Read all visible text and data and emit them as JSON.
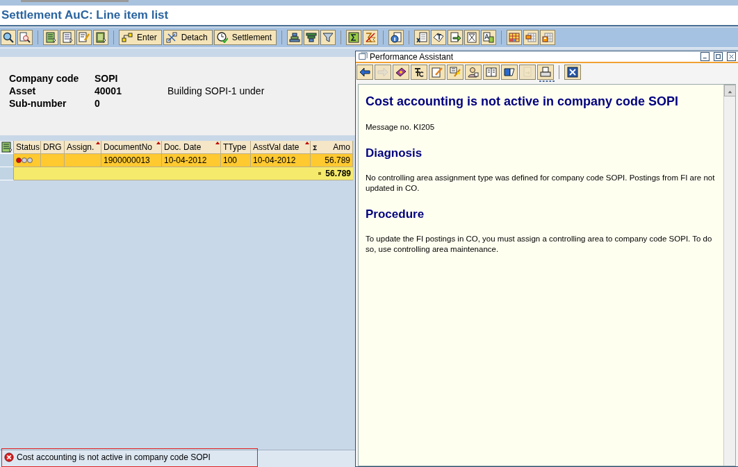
{
  "window": {
    "title": "Settlement AuC: Line item list"
  },
  "toolbar": [
    {
      "kind": "icon"
    },
    {
      "kind": "icon"
    },
    {
      "kind": "separator"
    },
    {
      "kind": "icon"
    },
    {
      "kind": "icon"
    },
    {
      "kind": "icon"
    },
    {
      "kind": "icon"
    },
    {
      "kind": "separator"
    },
    {
      "kind": "text",
      "label": "Enter"
    },
    {
      "kind": "text",
      "label": "Detach"
    },
    {
      "kind": "text",
      "label": "Settlement"
    },
    {
      "kind": "separator"
    },
    {
      "kind": "icon"
    },
    {
      "kind": "icon"
    },
    {
      "kind": "icon"
    },
    {
      "kind": "separator"
    },
    {
      "kind": "icon"
    },
    {
      "kind": "icon"
    },
    {
      "kind": "separator"
    },
    {
      "kind": "icon"
    },
    {
      "kind": "separator"
    },
    {
      "kind": "icon"
    },
    {
      "kind": "icon"
    },
    {
      "kind": "icon"
    },
    {
      "kind": "icon"
    },
    {
      "kind": "icon"
    },
    {
      "kind": "separator"
    },
    {
      "kind": "icon"
    },
    {
      "kind": "icon"
    },
    {
      "kind": "icon"
    }
  ],
  "header_fields": [
    {
      "label": "Company code",
      "value": "SOPI"
    },
    {
      "label": "Asset",
      "value": "40001",
      "description": "Building SOPI-1 under"
    },
    {
      "label": "Sub-number",
      "value": "0"
    }
  ],
  "table": {
    "columns": [
      {
        "label": "Status",
        "sorted": false
      },
      {
        "label": "DRG",
        "sorted": false
      },
      {
        "label": "Assign.",
        "sorted": true
      },
      {
        "label": "DocumentNo",
        "sorted": true
      },
      {
        "label": "Doc. Date",
        "sorted": true
      },
      {
        "label": "TType",
        "sorted": false
      },
      {
        "label": "AsstVal date",
        "sorted": true
      },
      {
        "label": "Amo",
        "sorted": false,
        "kind": "sum"
      }
    ],
    "rows": [
      {
        "lights": [
          {
            "color": "#e00000"
          },
          {
            "color": "#d0d0e0"
          },
          {
            "color": "#d0d0e0"
          }
        ],
        "cells": [
          "",
          "",
          "",
          "1900000013",
          "10-04-2012",
          "100",
          "10-04-2012",
          "56.789"
        ]
      }
    ],
    "total": "56.789"
  },
  "status_bar": {
    "error": true,
    "message": "Cost accounting is not active in company code SOPI"
  },
  "assistant": {
    "title": "Performance Assistant",
    "toolbar": [
      {
        "disabled": false
      },
      {
        "disabled": true
      },
      {
        "disabled": false
      },
      {
        "disabled": false
      },
      {
        "disabled": false
      },
      {
        "disabled": false
      },
      {
        "disabled": false
      },
      {
        "disabled": false
      },
      {
        "disabled": false
      },
      {
        "disabled": true
      },
      {
        "disabled": false
      }
    ],
    "heading": "Cost accounting is not active in company code SOPI",
    "message_no": "Message no. KI205",
    "sections": [
      {
        "title": "Diagnosis",
        "text": "No controlling area assignment type was defined for company code SOPI. Postings from FI are not updated in CO."
      },
      {
        "title": "Procedure",
        "text": "To update the FI postings in CO, you must assign a controlling area to company code SOPI. To do so, use controlling area maintenance."
      }
    ]
  }
}
